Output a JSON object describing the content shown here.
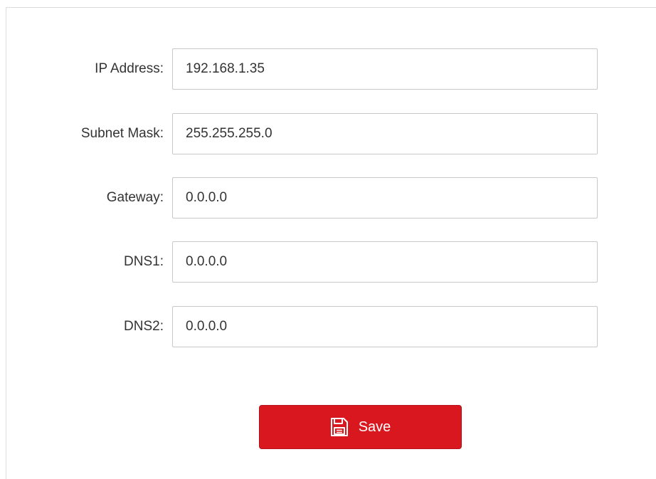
{
  "form": {
    "fields": [
      {
        "label": "IP Address:",
        "value": "192.168.1.35"
      },
      {
        "label": "Subnet Mask:",
        "value": "255.255.255.0"
      },
      {
        "label": "Gateway:",
        "value": "0.0.0.0"
      },
      {
        "label": "DNS1:",
        "value": "0.0.0.0"
      },
      {
        "label": "DNS2:",
        "value": "0.0.0.0"
      }
    ],
    "save_button": {
      "label": "Save",
      "icon": "save-icon"
    }
  },
  "colors": {
    "accent": "#d9171e",
    "text": "#333333",
    "input_border": "#c8c8c8"
  }
}
